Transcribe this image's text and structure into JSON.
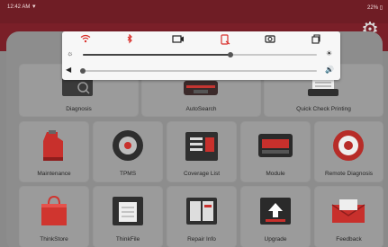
{
  "status_bar": {
    "time": "12:42",
    "time_suffix": "AM",
    "battery": "22%"
  },
  "tiles": [
    {
      "label": "Diagnosis",
      "icon": "diagnosis-icon"
    },
    {
      "label": "AutoSearch",
      "icon": "autosearch-icon"
    },
    {
      "label": "Quick Check Printing",
      "icon": "quick-check-printing-icon"
    },
    {
      "label": "Maintenance",
      "icon": "maintenance-icon"
    },
    {
      "label": "TPMS",
      "icon": "tpms-tire-icon"
    },
    {
      "label": "Coverage List",
      "icon": "coverage-list-icon"
    },
    {
      "label": "Module",
      "icon": "module-icon"
    },
    {
      "label": "Remote Diagnosis",
      "icon": "remote-diagnosis-icon"
    },
    {
      "label": "ThinkStore",
      "icon": "thinkstore-bag-icon"
    },
    {
      "label": "ThinkFile",
      "icon": "thinkfile-icon"
    },
    {
      "label": "Repair Info",
      "icon": "repair-info-book-icon"
    },
    {
      "label": "Upgrade",
      "icon": "upgrade-icon"
    },
    {
      "label": "Feedback",
      "icon": "feedback-mail-icon"
    }
  ],
  "quick_settings": {
    "toggles": [
      {
        "name": "wifi-toggle-icon",
        "active": true
      },
      {
        "name": "bluetooth-toggle-icon",
        "active": true
      },
      {
        "name": "screen-record-icon",
        "active": false
      },
      {
        "name": "rotation-lock-icon",
        "active": true
      },
      {
        "name": "screenshot-camera-icon",
        "active": false
      },
      {
        "name": "copy-clipboard-icon",
        "active": false
      }
    ],
    "brightness_level": 0.63,
    "volume_level": 0.0
  },
  "colors": {
    "header": "#7a1f28",
    "accent_red": "#d9302c",
    "panel": "#f7f7f7"
  }
}
